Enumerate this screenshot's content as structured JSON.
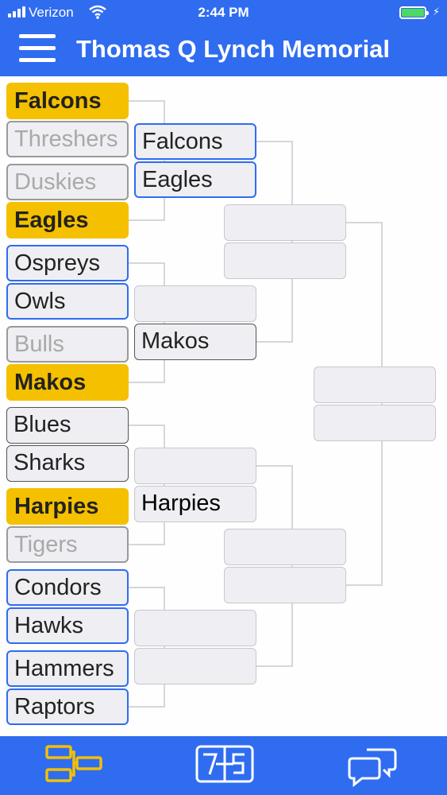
{
  "status_bar": {
    "carrier": "Verizon",
    "time": "2:44 PM"
  },
  "header": {
    "title": "Thomas Q Lynch Memorial",
    "menu_icon": "hamburger-menu-icon"
  },
  "bracket": {
    "round1": [
      {
        "name": "Falcons",
        "state": "winner"
      },
      {
        "name": "Threshers",
        "state": "lost"
      },
      {
        "name": "Duskies",
        "state": "lost"
      },
      {
        "name": "Eagles",
        "state": "winner"
      },
      {
        "name": "Ospreys",
        "state": "active"
      },
      {
        "name": "Owls",
        "state": "active"
      },
      {
        "name": "Bulls",
        "state": "lost"
      },
      {
        "name": "Makos",
        "state": "winner"
      },
      {
        "name": "Blues",
        "state": "plain"
      },
      {
        "name": "Sharks",
        "state": "plain"
      },
      {
        "name": "Harpies",
        "state": "winner"
      },
      {
        "name": "Tigers",
        "state": "lost"
      },
      {
        "name": "Condors",
        "state": "active"
      },
      {
        "name": "Hawks",
        "state": "active"
      },
      {
        "name": "Hammers",
        "state": "active"
      },
      {
        "name": "Raptors",
        "state": "active"
      }
    ],
    "round2": [
      {
        "name": "Falcons",
        "state": "active"
      },
      {
        "name": "Eagles",
        "state": "active"
      },
      {
        "name": "",
        "state": "empty"
      },
      {
        "name": "Makos",
        "state": "plain"
      },
      {
        "name": "",
        "state": "empty"
      },
      {
        "name": "Harpies",
        "state": "empty"
      },
      {
        "name": "",
        "state": "empty"
      },
      {
        "name": "",
        "state": "empty"
      }
    ],
    "round3": [
      {
        "name": "",
        "state": "empty"
      },
      {
        "name": "",
        "state": "empty"
      },
      {
        "name": "",
        "state": "empty"
      },
      {
        "name": "",
        "state": "empty"
      }
    ],
    "round4": [
      {
        "name": "",
        "state": "empty"
      },
      {
        "name": "",
        "state": "empty"
      }
    ]
  },
  "tabbar": {
    "tabs": [
      {
        "icon": "bracket-icon",
        "selected": true
      },
      {
        "icon": "scoreboard-icon",
        "selected": false
      },
      {
        "icon": "chat-bubbles-icon",
        "selected": false
      }
    ]
  },
  "colors": {
    "primary": "#2f6cf0",
    "winner": "#f4c000",
    "tab_selected": "#f4c000",
    "tab_default": "#ffffff"
  }
}
